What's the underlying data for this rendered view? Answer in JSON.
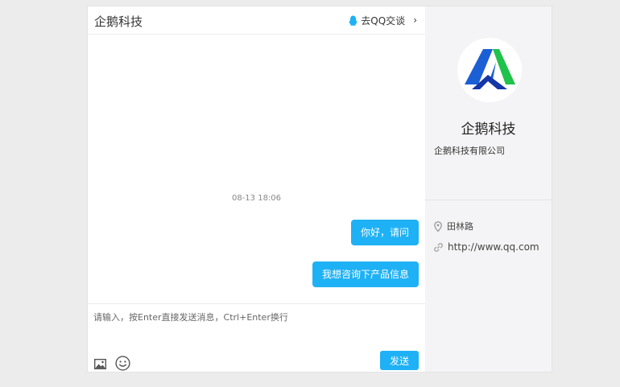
{
  "header": {
    "title": "企鹅科技",
    "qq_link_label": "去QQ交谈",
    "chevron": "›"
  },
  "messages": {
    "timestamp": "08-13 18:06",
    "items": [
      {
        "text": "你好，请问"
      },
      {
        "text": "我想咨询下产品信息"
      }
    ]
  },
  "composer": {
    "placeholder": "请输入，按Enter直接发送消息，Ctrl+Enter换行",
    "value": "",
    "send_label": "发送",
    "tools": [
      "image-icon",
      "emoji-icon"
    ]
  },
  "profile": {
    "name": "企鹅科技",
    "full_name": "企鹅科技有限公司",
    "address": "田林路",
    "website": "http://www.qq.com",
    "logo": "company-logo"
  },
  "colors": {
    "accent": "#1fb1f5",
    "page_bg": "#ececec",
    "profile_bg": "#f4f4f6",
    "logo_blue": "#1a5fd4",
    "logo_green": "#1fc24a"
  }
}
